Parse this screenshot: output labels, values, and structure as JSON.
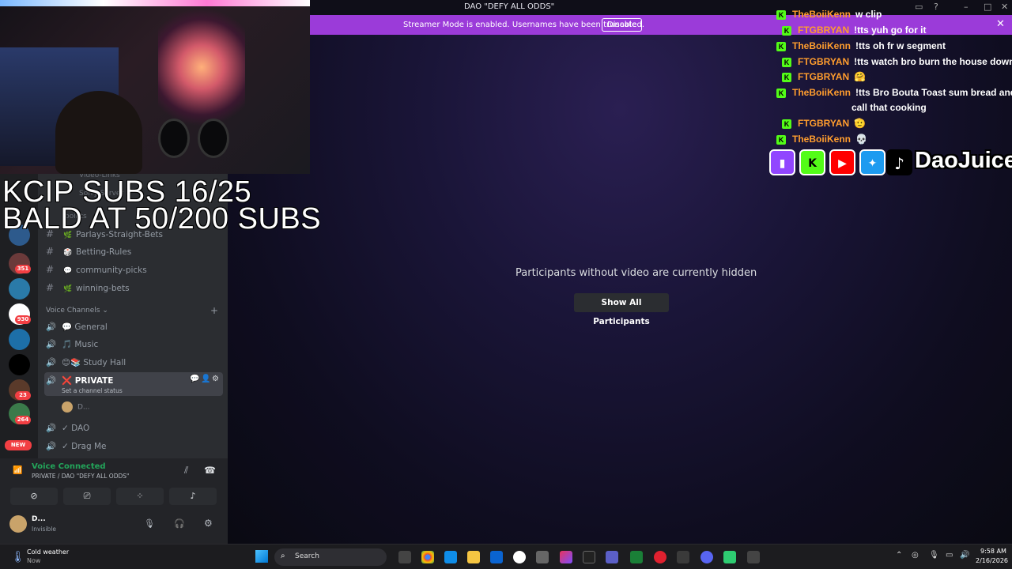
{
  "window": {
    "title": "DAO \"DEFY ALL ODDS\""
  },
  "streamer_banner": {
    "message": "Streamer Mode is enabled. Usernames have been truncated.",
    "disable_label": "Disable"
  },
  "stage": {
    "hidden_message": "Participants without video are currently hidden",
    "show_all_label": "Show All Participants"
  },
  "overlay": {
    "line1": "KCIP SUBS 16/25",
    "line2": "BALD AT 50/200 SUBS"
  },
  "channels": {
    "partial_top": [
      "Video-Links",
      "Sorry Server",
      "points"
    ],
    "text": [
      {
        "name": "Parlays-Straight-Bets",
        "emoji": "🌿"
      },
      {
        "name": "Betting-Rules",
        "emoji": "🎲"
      },
      {
        "name": "community-picks",
        "emoji": "💬"
      },
      {
        "name": "winning-bets",
        "emoji": "🌿"
      }
    ],
    "voice_header": "Voice Channels",
    "voice": [
      {
        "name": "General",
        "emoji": "💬"
      },
      {
        "name": "Music",
        "emoji": "🎵"
      },
      {
        "name": "Study Hall",
        "emoji": "😊📚"
      },
      {
        "name": "PRIVATE",
        "emoji": "❌",
        "status": "Set a channel status"
      },
      {
        "name": "DAO",
        "emoji": "✓"
      },
      {
        "name": "Drag Me",
        "emoji": "✓"
      }
    ],
    "member_in_private": "D..."
  },
  "servers": {
    "badges": [
      "351",
      "930",
      "23",
      "264",
      "NEW"
    ]
  },
  "voice_panel": {
    "status": "Voice Connected",
    "location": "PRIVATE / DAO \"DEFY ALL ODDS\""
  },
  "user": {
    "name": "D...",
    "status": "Invisible"
  },
  "chat": [
    {
      "name": "TheBoiiKenn",
      "text": "w clip",
      "color": "#ff9d2e"
    },
    {
      "name": "FTGBRYAN",
      "text": "!tts yuh go for it",
      "color": "#ff9d2e"
    },
    {
      "name": "TheBoiiKenn",
      "text": "!tts oh fr w segment",
      "color": "#ff9d2e"
    },
    {
      "name": "FTGBRYAN",
      "text": "!tts watch bro burn the house down",
      "color": "#ff9d2e"
    },
    {
      "name": "FTGBRYAN",
      "text": "🤗",
      "color": "#ff9d2e"
    },
    {
      "name": "TheBoiiKenn",
      "text": "!tts Bro Bouta Toast sum bread and",
      "text2": "call that cooking",
      "color": "#ff9d2e"
    },
    {
      "name": "FTGBRYAN",
      "text": "🫡",
      "color": "#ff9d2e"
    },
    {
      "name": "TheBoiiKenn",
      "text": "💀",
      "color": "#ff9d2e"
    }
  ],
  "social": {
    "handle": "DaoJuice",
    "icons": [
      "twitch-icon",
      "kick-icon",
      "youtube-icon",
      "twitter-icon",
      "tiktok-icon"
    ]
  },
  "taskbar": {
    "weather_title": "Cold weather",
    "weather_sub": "Now",
    "search_placeholder": "Search",
    "time": "9:58 AM",
    "date": "2/16/2026"
  }
}
